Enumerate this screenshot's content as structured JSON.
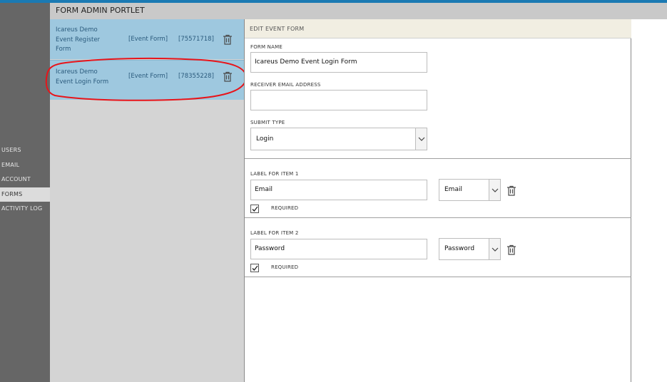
{
  "header": {
    "title": "FORM ADMIN PORTLET"
  },
  "nav": {
    "items": [
      {
        "label": "USERS"
      },
      {
        "label": "EMAIL"
      },
      {
        "label": "ACCOUNT"
      },
      {
        "label": "FORMS",
        "active": true
      },
      {
        "label": "ACTIVITY LOG"
      }
    ]
  },
  "forms_list": [
    {
      "name_line1": "Icareus Demo",
      "name_line2": "Event Register",
      "name_line3": "Form",
      "type": "[Event Form]",
      "id": "[75571718]"
    },
    {
      "name_line1": "Icareus Demo",
      "name_line2": "Event Login Form",
      "type": "[Event Form]",
      "id": "[78355228]",
      "selected": true
    }
  ],
  "edit": {
    "title": "EDIT EVENT FORM",
    "form_name_label": "FORM NAME",
    "form_name_value": "Icareus Demo Event Login Form",
    "receiver_label": "RECEIVER EMAIL ADDRESS",
    "receiver_value": "",
    "submit_type_label": "SUBMIT TYPE",
    "submit_type_value": "Login",
    "items": [
      {
        "label": "LABEL FOR ITEM 1",
        "value": "Email",
        "type": "Email",
        "required_label": "REQUIRED",
        "required": true
      },
      {
        "label": "LABEL FOR ITEM 2",
        "value": "Password",
        "type": "Password",
        "required_label": "REQUIRED",
        "required": true
      }
    ]
  },
  "colors": {
    "topbar": "#1b7ab3",
    "rail": "#666666",
    "list_item": "#9ec8df",
    "annotation": "#e8141a",
    "edit_header": "#f1eee2"
  },
  "icons": [
    "trash-icon",
    "chevron-down-icon",
    "checkmark-icon"
  ]
}
